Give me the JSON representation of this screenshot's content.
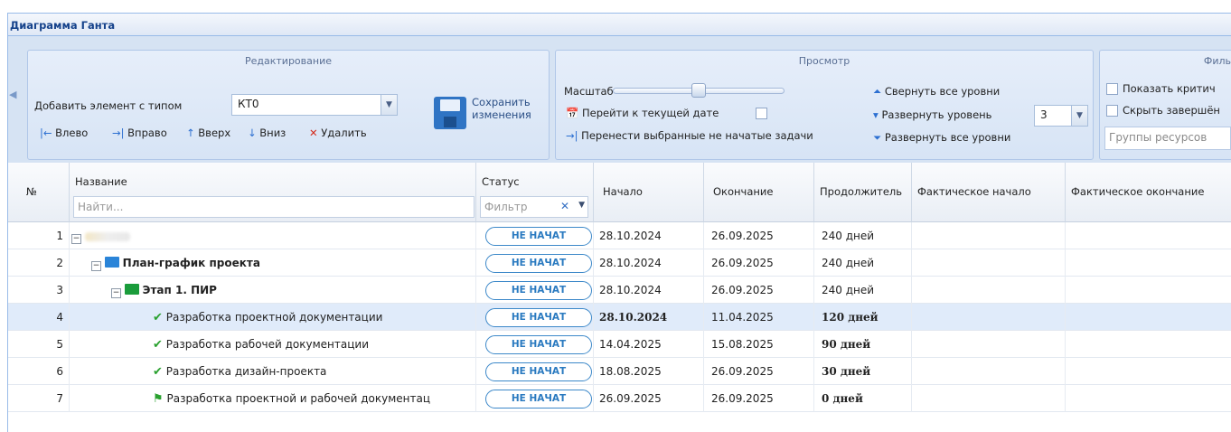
{
  "window": {
    "title": "Диаграмма Ганта"
  },
  "ribbon": {
    "edit": {
      "title": "Редактирование",
      "add_label": "Добавить элемент с типом",
      "add_type": "КТ0",
      "save_label_1": "Сохранить",
      "save_label_2": "изменения",
      "left": "Влево",
      "right": "Вправо",
      "up": "Вверх",
      "down": "Вниз",
      "delete": "Удалить"
    },
    "view": {
      "title": "Просмотр",
      "scale_label": "Масштаб",
      "scale_value": 0.5,
      "goto_today": "Перейти к текущей дате",
      "move_tasks": "Перенести выбранные не начатые задачи",
      "collapse_all": "Свернуть все уровни",
      "expand_level": "Развернуть уровень",
      "expand_level_value": "3",
      "expand_all": "Развернуть все уровни"
    },
    "filter": {
      "title": "Филь",
      "show_critical": "Показать критич",
      "hide_completed": "Скрыть завершён",
      "resource_groups_placeholder": "Группы ресурсов"
    }
  },
  "grid": {
    "columns": {
      "num": "№",
      "name": "Название",
      "name_filter_placeholder": "Найти...",
      "status": "Статус",
      "status_filter_placeholder": "Фильтр",
      "start": "Начало",
      "end": "Окончание",
      "duration": "Продолжитель",
      "actual_start": "Фактическое начало",
      "actual_end": "Фактическое окончание"
    },
    "rows": [
      {
        "num": "1",
        "name": "",
        "status": "НЕ НАЧАТ",
        "start": "28.10.2024",
        "end": "26.09.2025",
        "duration": "240 дней"
      },
      {
        "num": "2",
        "name": "План-график проекта",
        "status": "НЕ НАЧАТ",
        "start": "28.10.2024",
        "end": "26.09.2025",
        "duration": "240 дней"
      },
      {
        "num": "3",
        "name": "Этап 1. ПИР",
        "status": "НЕ НАЧАТ",
        "start": "28.10.2024",
        "end": "26.09.2025",
        "duration": "240 дней"
      },
      {
        "num": "4",
        "name": "Разработка проектной документации",
        "status": "НЕ НАЧАТ",
        "start": "28.10.2024",
        "end": "11.04.2025",
        "duration": "120 дней"
      },
      {
        "num": "5",
        "name": "Разработка рабочей документации",
        "status": "НЕ НАЧАТ",
        "start": "14.04.2025",
        "end": "15.08.2025",
        "duration": "90 дней"
      },
      {
        "num": "6",
        "name": "Разработка дизайн-проекта",
        "status": "НЕ НАЧАТ",
        "start": "18.08.2025",
        "end": "26.09.2025",
        "duration": "30 дней"
      },
      {
        "num": "7",
        "name": "Разработка проектной и рабочей документац",
        "status": "НЕ НАЧАТ",
        "start": "26.09.2025",
        "end": "26.09.2025",
        "duration": "0 дней"
      }
    ]
  }
}
